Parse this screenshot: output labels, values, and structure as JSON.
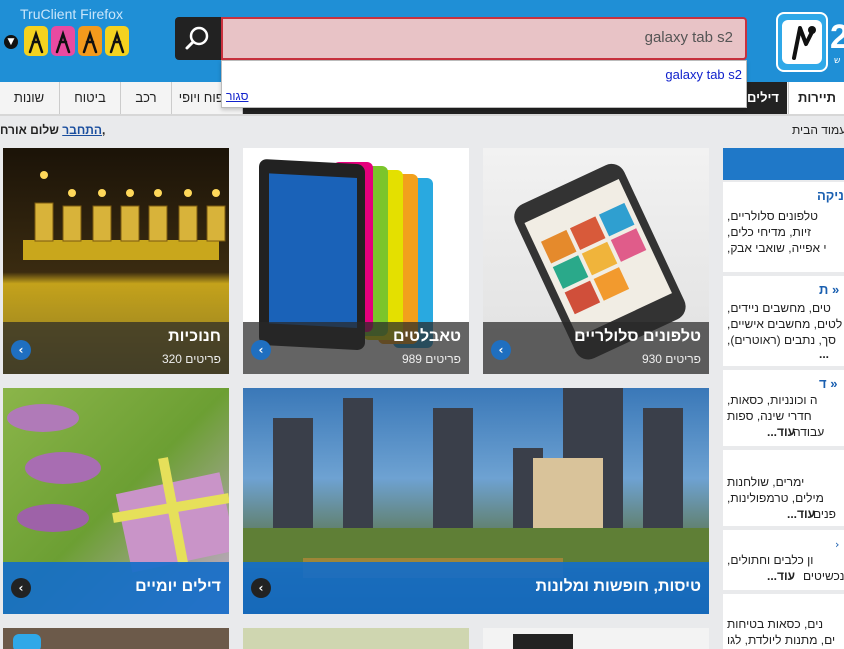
{
  "browser": {
    "title": "TruClient Firefox"
  },
  "search": {
    "value": "galaxy tab s2",
    "suggestion": "galaxy tab s2",
    "close_label": "סגור"
  },
  "site": {
    "logo_number": "2",
    "logo_sub": "ש"
  },
  "nav": {
    "items": [
      {
        "label": "שונות"
      },
      {
        "label": "ביטוח"
      },
      {
        "label": "רכב"
      },
      {
        "label": "טיפוח ויופי"
      },
      {
        "label": "דילים"
      },
      {
        "label": "תיירות"
      }
    ]
  },
  "userbar": {
    "greeting": "שלום אורח,",
    "login": "התחבר",
    "breadcrumb": "עמוד הבית"
  },
  "tiles": [
    {
      "title": "חנוכיות",
      "count": "320 פריטים"
    },
    {
      "title": "טאבלטים",
      "count": "989 פריטים"
    },
    {
      "title": "טלפונים סלולריים",
      "count": "930 פריטים"
    },
    {
      "title": "דילים יומיים"
    },
    {
      "title": "טיסות, חופשות ומלונות"
    }
  ],
  "sidebar": {
    "blocks": [
      {
        "title": "ניקה »",
        "lines": [
          "טלפונים סלולריים,",
          "זיות, מדיחי כלים,",
          "י אפייה, שואבי אבק,"
        ]
      },
      {
        "title": "ת »",
        "lines": [
          "טים, מחשבים ניידים,",
          "לטים, מחשבים אישיים,",
          "סך, נתבים (ראוטרים),"
        ],
        "more": "..."
      },
      {
        "title": "ד »",
        "lines": [
          "ה וכונניות, כסאות,",
          "חדרי שינה, ספות",
          "עבודה"
        ],
        "more": "עוד..."
      },
      {
        "title": "",
        "lines": [
          "ימרים, שולחנות",
          "מילים, טרמפולינות,",
          "פנים"
        ],
        "more": "עוד..."
      },
      {
        "title": "",
        "lines": [
          "ון כלבים וחתולים,",
          "נכשיטים"
        ],
        "more": "עוד..."
      },
      {
        "title": "",
        "lines": [
          "נים, כסאות בטיחות",
          "ים, מתנות ליולדת, לגו"
        ]
      }
    ]
  }
}
